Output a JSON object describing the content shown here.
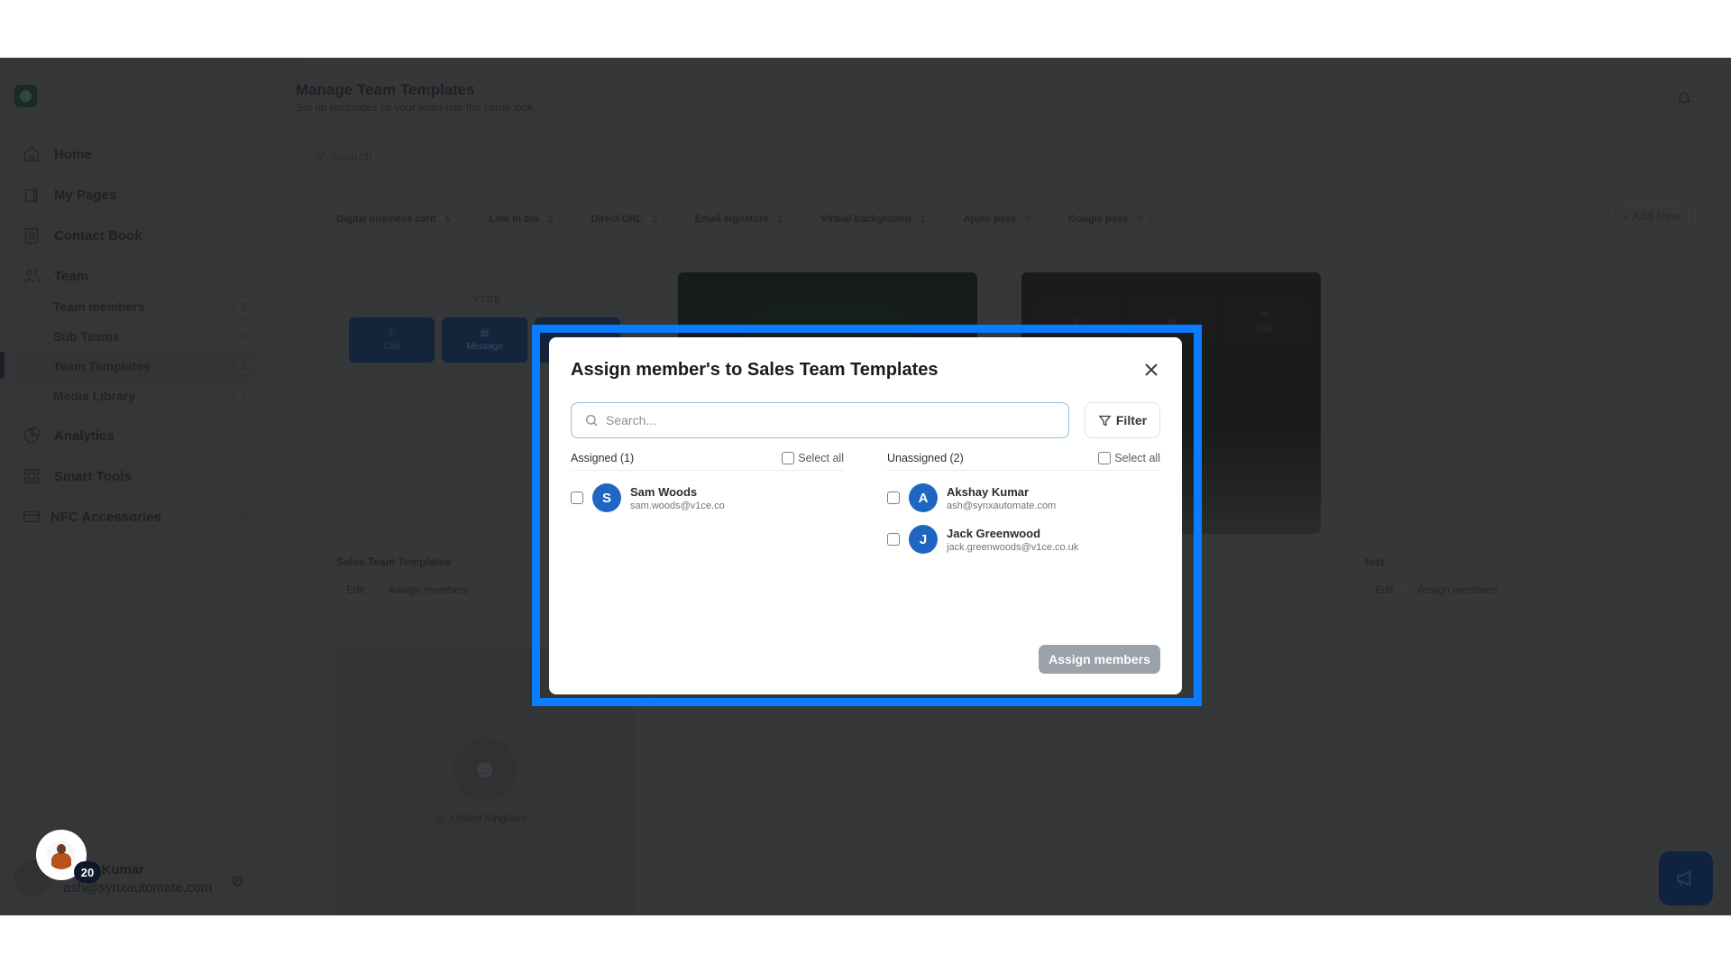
{
  "sidebar": {
    "nav": [
      {
        "label": "Home",
        "icon": "home-icon"
      },
      {
        "label": "My Pages",
        "icon": "pages-icon"
      },
      {
        "label": "Contact Book",
        "icon": "contact-book-icon"
      },
      {
        "label": "Team",
        "icon": "team-icon"
      },
      {
        "label": "Analytics",
        "icon": "analytics-icon"
      },
      {
        "label": "Smart Tools",
        "icon": "grid-icon"
      },
      {
        "label": "NFC Accessories",
        "icon": "card-icon"
      }
    ],
    "team_sub": [
      {
        "label": "Team members",
        "badge": "3"
      },
      {
        "label": "Sub Teams",
        "badge": "3"
      },
      {
        "label": "Team Templates",
        "badge": "i",
        "active": true
      },
      {
        "label": "Media Library",
        "badge": "i"
      }
    ],
    "user": {
      "name": "Akshay Kumar",
      "name_visible": "y Kumar",
      "email": "ash@synxautomate.com",
      "badge_count": "20"
    }
  },
  "header": {
    "title": "Manage Team Templates",
    "subtitle": "Set up templates so your team has the same look."
  },
  "toolbar": {
    "search_placeholder": "Search",
    "add_new_label": "Add New"
  },
  "tabs": [
    {
      "label": "Digital business card",
      "count": "5",
      "active": true
    },
    {
      "label": "Link in bio",
      "count": "1"
    },
    {
      "label": "Direct URL",
      "count": "1"
    },
    {
      "label": "Email signature",
      "count": "1"
    },
    {
      "label": "Virtual background",
      "count": "1"
    },
    {
      "label": "Apple pass",
      "count": "0"
    },
    {
      "label": "Google pass",
      "count": "0"
    }
  ],
  "cards": [
    {
      "name": "Sales Team Templates",
      "brand": "V1CE",
      "actions": [
        "Call",
        "Message"
      ],
      "edit_label": "Edit",
      "assign_label": "Assign members"
    },
    {
      "name": "test",
      "actions": [
        "Mail"
      ],
      "edit_label": "Edit",
      "assign_label": "Assign members"
    },
    {
      "location": "United Kingdom"
    }
  ],
  "modal": {
    "title": "Assign member's to Sales Team Templates",
    "search_placeholder": "Search...",
    "filter_label": "Filter",
    "assigned": {
      "heading": "Assigned (1)",
      "select_all": "Select all",
      "members": [
        {
          "initial": "S",
          "name": "Sam Woods",
          "email": "sam.woods@v1ce.co"
        }
      ]
    },
    "unassigned": {
      "heading": "Unassigned (2)",
      "select_all": "Select all",
      "members": [
        {
          "initial": "A",
          "name": "Akshay Kumar",
          "email": "ash@synxautomate.com"
        },
        {
          "initial": "J",
          "name": "Jack Greenwood",
          "email": "jack.greenwoods@v1ce.co.uk"
        }
      ]
    },
    "submit_label": "Assign members"
  },
  "colors": {
    "highlight": "#0a7cff",
    "avatar": "#1f66c2",
    "disabled_button": "#9ba1a9"
  }
}
